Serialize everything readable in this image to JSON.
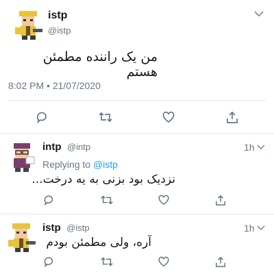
{
  "main_tweet": {
    "name": "istp",
    "handle": "@istp",
    "text": "من یک راننده مطمئن هستم",
    "timestamp": "8:02 PM • 21/07/2020"
  },
  "reply1": {
    "name": "intp",
    "handle": "@intp",
    "time": "1h",
    "replying_prefix": "Replying to",
    "replying_handle": "@istp",
    "text": "نزدیک بود بزنی به یه درخت..."
  },
  "reply2": {
    "name": "istp",
    "handle": "@istp",
    "time": "1h",
    "text": "آره، ولی مطمئن بودم"
  },
  "icons": [
    "reply-icon",
    "retweet-icon",
    "like-icon",
    "share-icon",
    "chevron-down-icon"
  ],
  "colors": {
    "icon": "#657786",
    "link": "#1da1f2",
    "divider": "#e1e8ed"
  }
}
